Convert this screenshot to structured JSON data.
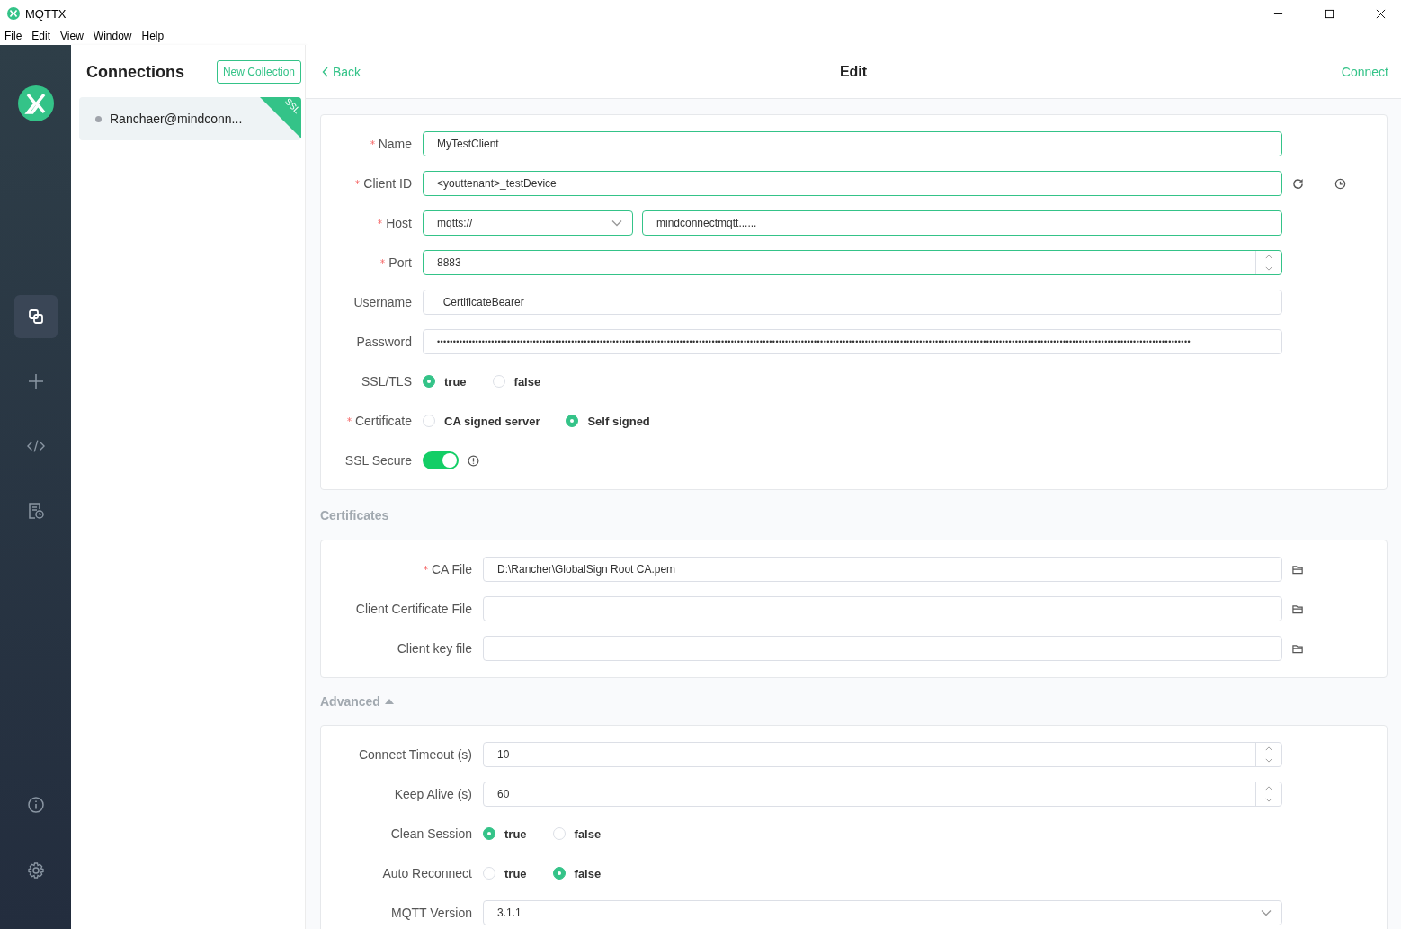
{
  "window": {
    "title": "MQTTX"
  },
  "menu": [
    "File",
    "Edit",
    "View",
    "Window",
    "Help"
  ],
  "nav": [
    {
      "selected": true
    },
    {
      "selected": false
    },
    {
      "selected": false
    },
    {
      "selected": false
    }
  ],
  "connections_panel": {
    "title": "Connections",
    "new_collection_button": "New Collection",
    "items": [
      {
        "name": "Ranchaer@mindconn...",
        "selected": true,
        "color": "#a0a4ab",
        "badge": "SSL"
      }
    ]
  },
  "header": {
    "back": "Back",
    "title": "Edit",
    "connect": "Connect"
  },
  "general": {
    "fields": [
      {
        "kind": "text",
        "label": "Name",
        "required": true,
        "value": "MyTestClient",
        "focused": true
      },
      {
        "kind": "client-id",
        "label": "Client ID",
        "required": true,
        "value": "<youttenant>_testDevice",
        "focused": true
      },
      {
        "kind": "host",
        "label": "Host",
        "required": true,
        "protocol": "mqtts://",
        "value": "mindconnectmqtt......",
        "focused": true
      },
      {
        "kind": "number",
        "label": "Port",
        "required": true,
        "value": "8883",
        "focused": true
      },
      {
        "kind": "text",
        "label": "Username",
        "required": false,
        "value": "_CertificateBearer",
        "focused": false
      },
      {
        "kind": "password",
        "label": "Password",
        "required": false,
        "value": "••••••••••••••••••••••••••••••••••••••••••••••••••••••••••••••••••••••••••••••••••••••••••••••••••••••••••••••••••••••••••••••••••••••••••••••••••••••••••••••••••••••••••••••••••••••••••••••••••••••••••••••••••••••••••••••••••••••••••••",
        "focused": false
      },
      {
        "kind": "radio",
        "label": "SSL/TLS",
        "required": false,
        "options": [
          {
            "label": "true",
            "selected": true
          },
          {
            "label": "false",
            "selected": false
          }
        ]
      },
      {
        "kind": "radio",
        "label": "Certificate",
        "required": true,
        "options": [
          {
            "label": "CA signed server",
            "selected": false
          },
          {
            "label": "Self signed",
            "selected": true
          }
        ]
      },
      {
        "kind": "switch",
        "label": "SSL Secure",
        "required": false,
        "on": true
      }
    ]
  },
  "certificates": {
    "title": "Certificates",
    "fields": [
      {
        "kind": "file",
        "label": "CA File",
        "required": true,
        "value": "D:\\Rancher\\GlobalSign Root CA.pem"
      },
      {
        "kind": "file",
        "label": "Client Certificate File",
        "required": false
      },
      {
        "kind": "file",
        "label": "Client key file",
        "required": false
      }
    ]
  },
  "advanced": {
    "title": "Advanced",
    "expanded": true,
    "fields": [
      {
        "kind": "number",
        "label": "Connect Timeout (s)",
        "required": false,
        "value": "10",
        "focused": false
      },
      {
        "kind": "number",
        "label": "Keep Alive (s)",
        "required": false,
        "value": "60",
        "focused": false
      },
      {
        "kind": "radio",
        "label": "Clean Session",
        "required": false,
        "options": [
          {
            "label": "true",
            "selected": true
          },
          {
            "label": "false",
            "selected": false
          }
        ]
      },
      {
        "kind": "radio",
        "label": "Auto Reconnect",
        "required": false,
        "options": [
          {
            "label": "true",
            "selected": false
          },
          {
            "label": "false",
            "selected": true
          }
        ]
      },
      {
        "kind": "select",
        "label": "MQTT Version",
        "required": false,
        "value": "3.1.1"
      }
    ]
  }
}
